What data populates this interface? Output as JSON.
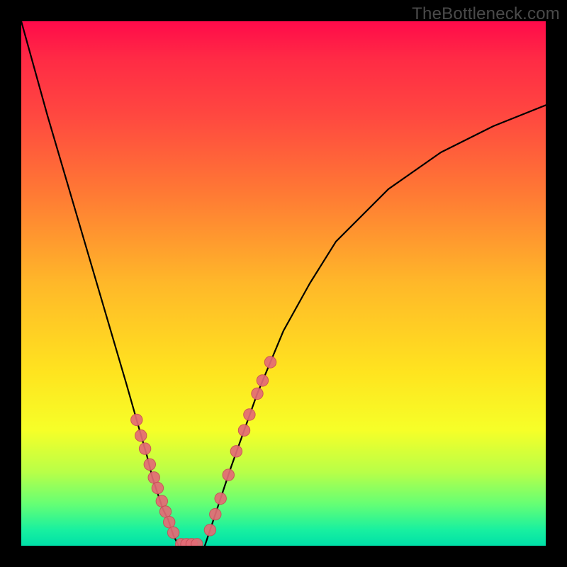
{
  "watermark": {
    "text": "TheBottleneck.com"
  },
  "chart_data": {
    "type": "line",
    "title": "",
    "xlabel": "",
    "ylabel": "",
    "xlim": [
      0,
      100
    ],
    "ylim": [
      0,
      100
    ],
    "grid": false,
    "legend": false,
    "series": [
      {
        "name": "left-curve",
        "x": [
          0,
          5,
          10,
          15,
          20,
          22,
          24,
          25,
          26,
          27,
          28,
          29,
          30
        ],
        "y": [
          100,
          82,
          65,
          48,
          31,
          24,
          17,
          13,
          10,
          7,
          5,
          2,
          0
        ]
      },
      {
        "name": "right-curve",
        "x": [
          35,
          36,
          37,
          38,
          40,
          45,
          50,
          55,
          60,
          70,
          80,
          90,
          100
        ],
        "y": [
          0,
          3,
          6,
          9,
          15,
          29,
          41,
          50,
          58,
          68,
          75,
          80,
          84
        ]
      }
    ],
    "markers": [
      {
        "name": "left-curve-marker",
        "x": 22.0,
        "y": 24.0
      },
      {
        "name": "left-curve-marker",
        "x": 22.8,
        "y": 21.0
      },
      {
        "name": "left-curve-marker",
        "x": 23.6,
        "y": 18.5
      },
      {
        "name": "left-curve-marker",
        "x": 24.5,
        "y": 15.5
      },
      {
        "name": "left-curve-marker",
        "x": 25.3,
        "y": 13.0
      },
      {
        "name": "left-curve-marker",
        "x": 26.0,
        "y": 11.0
      },
      {
        "name": "left-curve-marker",
        "x": 26.8,
        "y": 8.5
      },
      {
        "name": "left-curve-marker",
        "x": 27.5,
        "y": 6.5
      },
      {
        "name": "left-curve-marker",
        "x": 28.2,
        "y": 4.5
      },
      {
        "name": "left-curve-marker",
        "x": 29.0,
        "y": 2.5
      },
      {
        "name": "valley-marker",
        "x": 30.5,
        "y": 0.3
      },
      {
        "name": "valley-marker",
        "x": 31.5,
        "y": 0.3
      },
      {
        "name": "valley-marker",
        "x": 32.5,
        "y": 0.3
      },
      {
        "name": "valley-marker",
        "x": 33.5,
        "y": 0.3
      },
      {
        "name": "right-curve-marker",
        "x": 36.0,
        "y": 3.0
      },
      {
        "name": "right-curve-marker",
        "x": 37.0,
        "y": 6.0
      },
      {
        "name": "right-curve-marker",
        "x": 38.0,
        "y": 9.0
      },
      {
        "name": "right-curve-marker",
        "x": 39.5,
        "y": 13.5
      },
      {
        "name": "right-curve-marker",
        "x": 41.0,
        "y": 18.0
      },
      {
        "name": "right-curve-marker",
        "x": 42.5,
        "y": 22.0
      },
      {
        "name": "right-curve-marker",
        "x": 43.5,
        "y": 25.0
      },
      {
        "name": "right-curve-marker",
        "x": 45.0,
        "y": 29.0
      },
      {
        "name": "right-curve-marker",
        "x": 46.0,
        "y": 31.5
      },
      {
        "name": "right-curve-marker",
        "x": 47.5,
        "y": 35.0
      }
    ],
    "marker_radius": 8.2
  }
}
